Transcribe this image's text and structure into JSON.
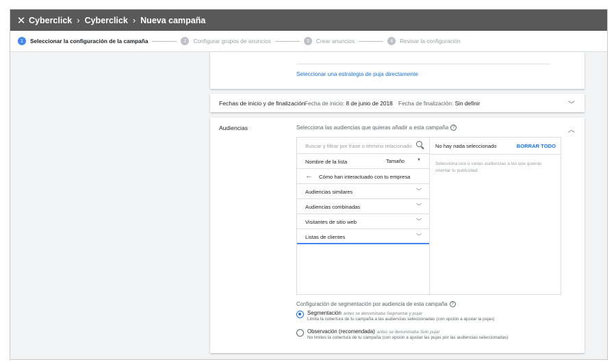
{
  "topbar": {
    "close_icon": "close-icon",
    "breadcrumbs": [
      "Cyberclick",
      "Cyberclick",
      "Nueva campaña"
    ],
    "separator": "›"
  },
  "stepper": {
    "steps": [
      {
        "number": "1",
        "label": "Seleccionar la configuración de la campaña",
        "state": "active"
      },
      {
        "number": "2",
        "label": "Configurar grupos de anuncios",
        "state": "pending"
      },
      {
        "number": "3",
        "label": "Crear anuncios",
        "state": "pending"
      },
      {
        "number": "4",
        "label": "Revisar la configuración",
        "state": "pending"
      }
    ]
  },
  "bidding": {
    "link": "Seleccionar una estrategia de puja directamente"
  },
  "dates": {
    "title": "Fechas de inicio y de finalización",
    "start_label": "Fecha de inicio:",
    "start_value": "8 de junio de 2018",
    "end_label": "Fecha de finalización:",
    "end_value": "Sin definir"
  },
  "audiences": {
    "title": "Audiencias",
    "prompt": "Selecciona las audiencias que quieras añadir a esta campaña",
    "search_placeholder": "Buscar y filtrar por frase o término relacionado",
    "col_name": "Nombre de la lista",
    "col_size": "Tamaño",
    "back_label": "Cómo han interactuado con tu empresa",
    "items": [
      "Audiencias similares",
      "Audiencias combinadas",
      "Visitantes de sitio web",
      "Listas de clientes"
    ],
    "selected_item_index": 3,
    "none_selected": "No hay nada seleccionado",
    "clear_all": "BORRAR TODO",
    "hint": "Selecciona una o varias audiencias a las que quieras orientar tu publicidad.",
    "targeting_title": "Configuración de segmentación por audiencia de esta campaña",
    "options": [
      {
        "label": "Segmentación",
        "note": "antes se denominaba Segmentar y pujar",
        "desc": "Limita la cobertura de tu campaña a las audiencias seleccionadas (con opción a ajustar la pujas)",
        "checked": true
      },
      {
        "label": "Observación (recomendada)",
        "note": "antes se denominaba Solo pujar",
        "desc": "No limites la cobertura de tu campaña (con opción a ajustar las pujas por las audiencias seleccionadas)",
        "checked": false
      }
    ]
  },
  "colors": {
    "topbar_bg": "#595959",
    "accent": "#1a73e8",
    "step_active": "#4285f4"
  }
}
